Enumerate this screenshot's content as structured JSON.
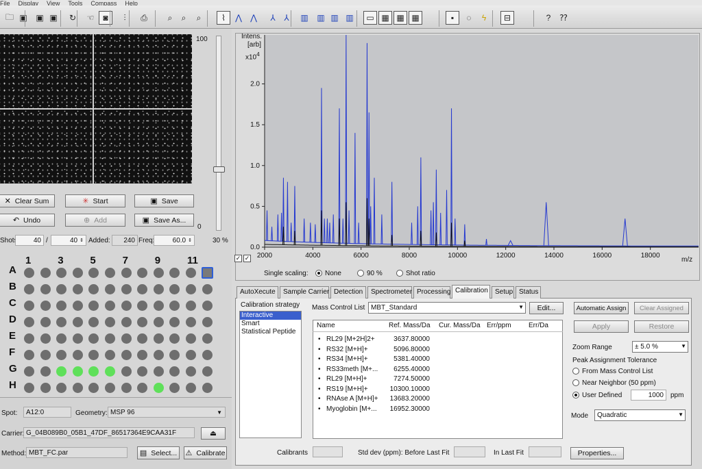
{
  "menu": [
    "File",
    "Display",
    "View",
    "Tools",
    "Compass",
    "Help"
  ],
  "toolbar_icons": [
    "open-icon",
    "save-icon",
    "save-all-icon",
    "save-as-icon",
    "refresh-icon",
    "hand-icon",
    "camera-icon",
    "bars-icon",
    "print-icon",
    "zoom-in-icon",
    "zoom-region-icon",
    "zoom-out-icon",
    "spectrum-tool-icon",
    "peak-icon",
    "peak-plus-icon",
    "peak-mark-icon",
    "peak-select-icon",
    "bar-group-a-icon",
    "bar-group-b-icon",
    "bar-group-c-icon",
    "bar-group-d-icon",
    "window-a-icon",
    "window-b-icon",
    "window-c-icon",
    "window-d-icon",
    "spot-icon",
    "circle-icon",
    "lightning-icon",
    "zoom-fit-icon",
    "help-icon",
    "context-help-icon"
  ],
  "camera": {
    "slider_max": "100",
    "slider_min": "0",
    "slider_pct": "30 %",
    "buttons": {
      "clear_sum": "Clear Sum",
      "start": "Start",
      "save": "Save",
      "undo": "Undo",
      "add": "Add",
      "save_as": "Save As..."
    },
    "shots_label": "Shots:",
    "shots_value": "40",
    "shots_sep": "/",
    "shots_total": "40",
    "added_label": "Added:",
    "added_value": "240",
    "freq_label": "Freq:",
    "freq_value": "60.0"
  },
  "plate": {
    "columns": [
      "1",
      "3",
      "5",
      "7",
      "9",
      "11"
    ],
    "rows": [
      "A",
      "B",
      "C",
      "D",
      "E",
      "F",
      "G",
      "H"
    ],
    "green_wells": [
      [
        6,
        2
      ],
      [
        6,
        3
      ],
      [
        6,
        4
      ],
      [
        6,
        5
      ],
      [
        7,
        8
      ]
    ],
    "selected_well": [
      0,
      11
    ]
  },
  "spot_panel": {
    "spot_label": "Spot:",
    "spot_value": "A12:0",
    "geometry_label": "Geometry:",
    "geometry_value": "MSP 96",
    "carrier_label": "Carrier:",
    "carrier_value": "G_04B089B0_05B1_47DF_86517364E9CAA31F",
    "method_label": "Method:",
    "method_value": "MBT_FC.par",
    "select_button": "Select...",
    "calibrate_button": "Calibrate"
  },
  "chart_data": {
    "type": "line",
    "ylabel": "Intens.",
    "yunit": "[arb]",
    "yscale": "x10",
    "yscale_exp": "4",
    "xlabel": "m/z",
    "xlim": [
      2000,
      20000
    ],
    "ylim": [
      0,
      2.6
    ],
    "xticks": [
      "2000",
      "4000",
      "6000",
      "8000",
      "10000",
      "12000",
      "14000",
      "16000",
      "18000"
    ],
    "yticks": [
      "0.0",
      "0.5",
      "1.0",
      "1.5",
      "2.0"
    ],
    "series": [
      {
        "color": "#2438d0",
        "peaks": [
          [
            2100,
            0.45
          ],
          [
            2300,
            0.25
          ],
          [
            2550,
            0.4
          ],
          [
            2700,
            0.42
          ],
          [
            2780,
            0.85
          ],
          [
            2950,
            0.8
          ],
          [
            3100,
            0.3
          ],
          [
            3250,
            0.75
          ],
          [
            3640,
            0.35
          ],
          [
            3900,
            0.3
          ],
          [
            4100,
            0.28
          ],
          [
            4360,
            1.95
          ],
          [
            4480,
            0.35
          ],
          [
            4600,
            0.35
          ],
          [
            4700,
            0.3
          ],
          [
            4850,
            0.4
          ],
          [
            5100,
            1.7
          ],
          [
            5250,
            0.35
          ],
          [
            5380,
            2.6
          ],
          [
            5500,
            0.45
          ],
          [
            5750,
            1.4
          ],
          [
            5900,
            0.3
          ],
          [
            6250,
            2.5
          ],
          [
            6330,
            1.65
          ],
          [
            6400,
            0.5
          ],
          [
            6550,
            0.85
          ],
          [
            6860,
            0.4
          ],
          [
            7280,
            0.8
          ],
          [
            8100,
            0.3
          ],
          [
            8350,
            0.5
          ],
          [
            8480,
            1.1
          ],
          [
            8900,
            0.45
          ],
          [
            9000,
            0.55
          ],
          [
            9120,
            0.95
          ],
          [
            9300,
            0.42
          ],
          [
            9550,
            0.7
          ],
          [
            9750,
            1.7
          ],
          [
            9900,
            0.35
          ],
          [
            10300,
            0.28
          ],
          [
            11200,
            0.1
          ],
          [
            12200,
            0.08
          ],
          [
            13680,
            0.55
          ],
          [
            16950,
            0.35
          ]
        ]
      },
      {
        "color": "#111111",
        "peaks": [
          [
            2780,
            0.25
          ],
          [
            3250,
            0.2
          ],
          [
            4360,
            0.45
          ],
          [
            5100,
            0.35
          ],
          [
            5380,
            0.55
          ],
          [
            6250,
            0.6
          ],
          [
            6330,
            0.35
          ],
          [
            7280,
            0.15
          ],
          [
            8480,
            0.2
          ],
          [
            9120,
            0.18
          ],
          [
            9750,
            0.3
          ],
          [
            10300,
            0.08
          ]
        ]
      }
    ]
  },
  "plot_controls": {
    "single_scaling": "Single scaling:",
    "options": [
      "None",
      "90 %",
      "Shot ratio"
    ],
    "selected": 0
  },
  "tabs": [
    "AutoXecute",
    "Sample Carrier",
    "Detection",
    "Spectrometer",
    "Processing",
    "Calibration",
    "Setup",
    "Status"
  ],
  "active_tab": 5,
  "calibration": {
    "strategy_label": "Calibration strategy",
    "strategies": [
      "Interactive",
      "Smart",
      "Statistical Peptide"
    ],
    "selected_strategy": 0,
    "mcl_label": "Mass Control List",
    "mcl_value": "MBT_Standard",
    "edit_button": "Edit...",
    "columns": [
      "Name",
      "Ref. Mass/Da",
      "Cur. Mass/Da",
      "Err/ppm",
      "Err/Da"
    ],
    "rows": [
      {
        "name": "RL29 [M+2H]2+",
        "ref": "3637.80000"
      },
      {
        "name": "RS32 [M+H]+",
        "ref": "5096.80000"
      },
      {
        "name": "RS34 [M+H]+",
        "ref": "5381.40000"
      },
      {
        "name": "RS33meth [M+...",
        "ref": "6255.40000"
      },
      {
        "name": "RL29 [M+H]+",
        "ref": "7274.50000"
      },
      {
        "name": "RS19 [M+H]+",
        "ref": "10300.10000"
      },
      {
        "name": "RNAse A [M+H]+",
        "ref": "13683.20000"
      },
      {
        "name": "Myoglobin [M+...",
        "ref": "16952.30000"
      }
    ],
    "auto_assign": "Automatic Assign",
    "clear_assigned": "Clear Assigned",
    "apply": "Apply",
    "restore": "Restore",
    "zoom_range_label": "Zoom Range",
    "zoom_range_value": "± 5.0 %",
    "tolerance_label": "Peak Assignment Tolerance",
    "tolerance_options": [
      "From Mass Control List",
      "Near Neighbor (50 ppm)",
      "User Defined"
    ],
    "tolerance_selected": 2,
    "user_defined_value": "1000",
    "ppm": "ppm",
    "mode_label": "Mode",
    "mode_value": "Quadratic",
    "calibrants_label": "Calibrants",
    "stddev_label": "Std dev (ppm): Before Last Fit",
    "last_fit_label": "In Last Fit",
    "properties_button": "Properties..."
  }
}
